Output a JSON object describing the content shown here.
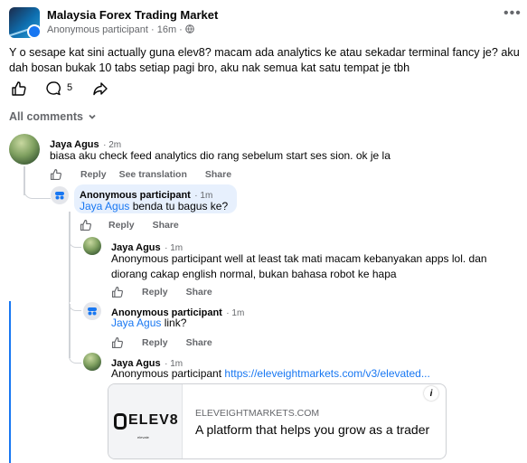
{
  "post": {
    "group_name": "Malaysia Forex Trading Market",
    "author": "Anonymous participant",
    "time": "16m",
    "body": "Y o sesape kat sini actually guna elev8? macam ada analytics ke atau sekadar terminal fancy je? aku dah bosan bukak 10 tabs setiap pagi bro, aku nak semua kat satu tempat je tbh",
    "comment_count": "5",
    "icons": [
      "like-icon",
      "comment-icon",
      "share-icon",
      "globe-icon",
      "more-icon"
    ]
  },
  "comments_header": {
    "label": "All comments"
  },
  "comments": [
    {
      "author": "Jaya Agus",
      "time": "2m",
      "text": "biasa aku check feed analytics dio rang sebelum start ses sion. ok je la",
      "actions": {
        "reply": "Reply",
        "translate": "See translation",
        "share": "Share"
      }
    },
    {
      "author": "Anonymous participant",
      "time": "1m",
      "mention": "Jaya Agus",
      "text": " benda tu bagus ke?",
      "actions": {
        "reply": "Reply",
        "share": "Share"
      }
    },
    {
      "author": "Jaya Agus",
      "time": "1m",
      "text": "Anonymous participant well at least tak mati macam kebanyakan apps lol. dan diorang cakap english normal, bukan bahasa robot ke hapa",
      "actions": {
        "reply": "Reply",
        "share": "Share"
      }
    },
    {
      "author": "Anonymous participant",
      "time": "1m",
      "mention": "Jaya Agus",
      "text": " link?",
      "actions": {
        "reply": "Reply",
        "share": "Share"
      }
    },
    {
      "author": "Jaya Agus",
      "time": "1m",
      "prefix": "Anonymous participant ",
      "link": "https://eleveightmarkets.com/v3/elevated...",
      "card": {
        "logo_text": "ELEV8",
        "logo_sub": "elevate",
        "domain": "ELEVEIGHTMARKETS.COM",
        "title": "A platform that helps you grow as a trader"
      }
    }
  ]
}
